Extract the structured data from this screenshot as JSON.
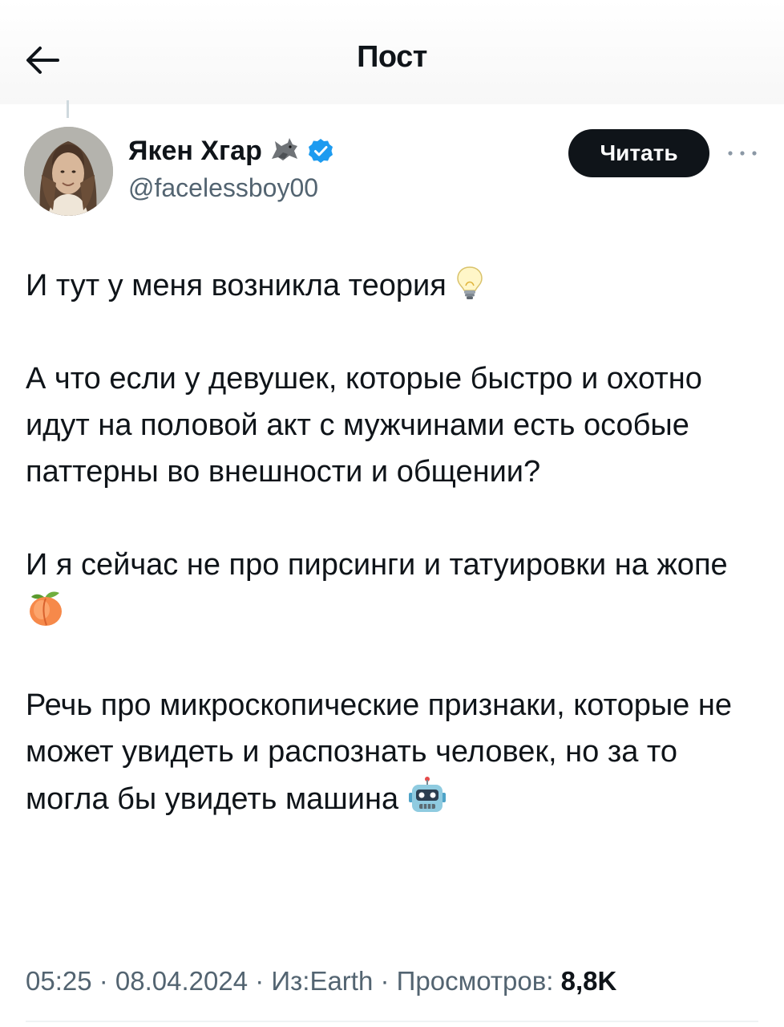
{
  "header": {
    "title": "Пост",
    "back_icon": "arrow-left-icon"
  },
  "author": {
    "name": "Якен Хгар",
    "name_emoji": "wolf-icon",
    "verified_icon": "verified-badge-icon",
    "handle": "@facelessboy00",
    "follow_label": "Читать",
    "more_icon": "more-dots-icon"
  },
  "tweet": {
    "paragraphs": [
      {
        "text": "И тут у меня возникла теория ",
        "emoji": "light-bulb-icon"
      },
      {
        "text": "А что если у девушек, которые быстро и охотно идут на половой акт с мужчинами есть особые паттерны во внешности и общении?"
      },
      {
        "text": "И я сейчас не про пирсинги и татуировки на жопе ",
        "emoji": "peach-icon"
      },
      {
        "text": "Речь про микроскопические признаки, которые не может увидеть и распознать человек, но за то могла бы увидеть машина ",
        "emoji": "robot-icon"
      }
    ]
  },
  "meta": {
    "time": "05:25",
    "date": "08.04.2024",
    "source": "Из:Earth",
    "views_label": "Просмотров:",
    "views_count": "8,8K",
    "separator": " · "
  },
  "colors": {
    "text": "#0f1419",
    "secondary": "#536471",
    "verified": "#1d9bf0",
    "follow_bg": "#0f1419"
  }
}
